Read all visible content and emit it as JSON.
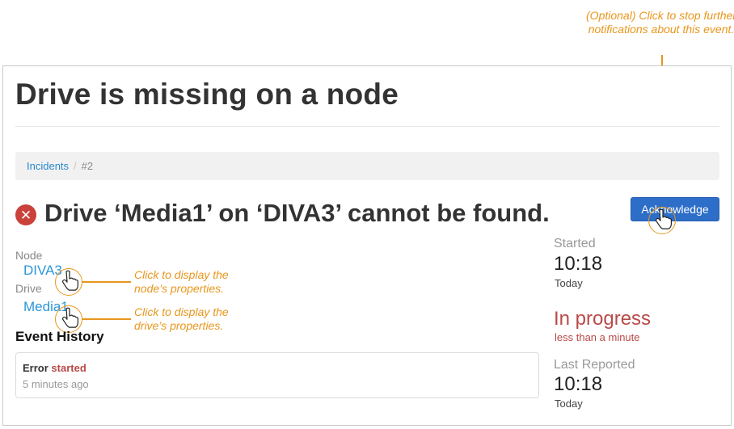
{
  "page": {
    "title": "Drive is missing on a node"
  },
  "breadcrumb": {
    "link": "Incidents",
    "separator": "/",
    "current": "#2"
  },
  "incident": {
    "status_icon": "error-circle-icon",
    "headline": "Drive ‘Media1’ on ‘DIVA3’ cannot be found.",
    "acknowledge_label": "Acknowledge"
  },
  "details": {
    "node_label": "Node",
    "node_value": "DIVA3",
    "drive_label": "Drive",
    "drive_value": "Media1"
  },
  "history": {
    "title": "Event History",
    "entries": [
      {
        "kind": "Error",
        "action": "started",
        "time": "5 minutes ago"
      }
    ]
  },
  "sidebar": {
    "started_label": "Started",
    "started_time": "10:18",
    "started_day": "Today",
    "status": "In progress",
    "status_duration": "less than a minute",
    "last_reported_label": "Last Reported",
    "last_reported_time": "10:18",
    "last_reported_day": "Today"
  },
  "annotations": {
    "acknowledge_note": "(Optional) Click to stop further notifications about this event.",
    "node_note": "Click to display the node’s properties.",
    "drive_note": "Click to display the drive’s properties."
  },
  "colors": {
    "accent_link": "#2a96d8",
    "button_blue": "#2d6ec9",
    "error_red": "#b94a48",
    "annotation_orange": "#e8961c"
  }
}
